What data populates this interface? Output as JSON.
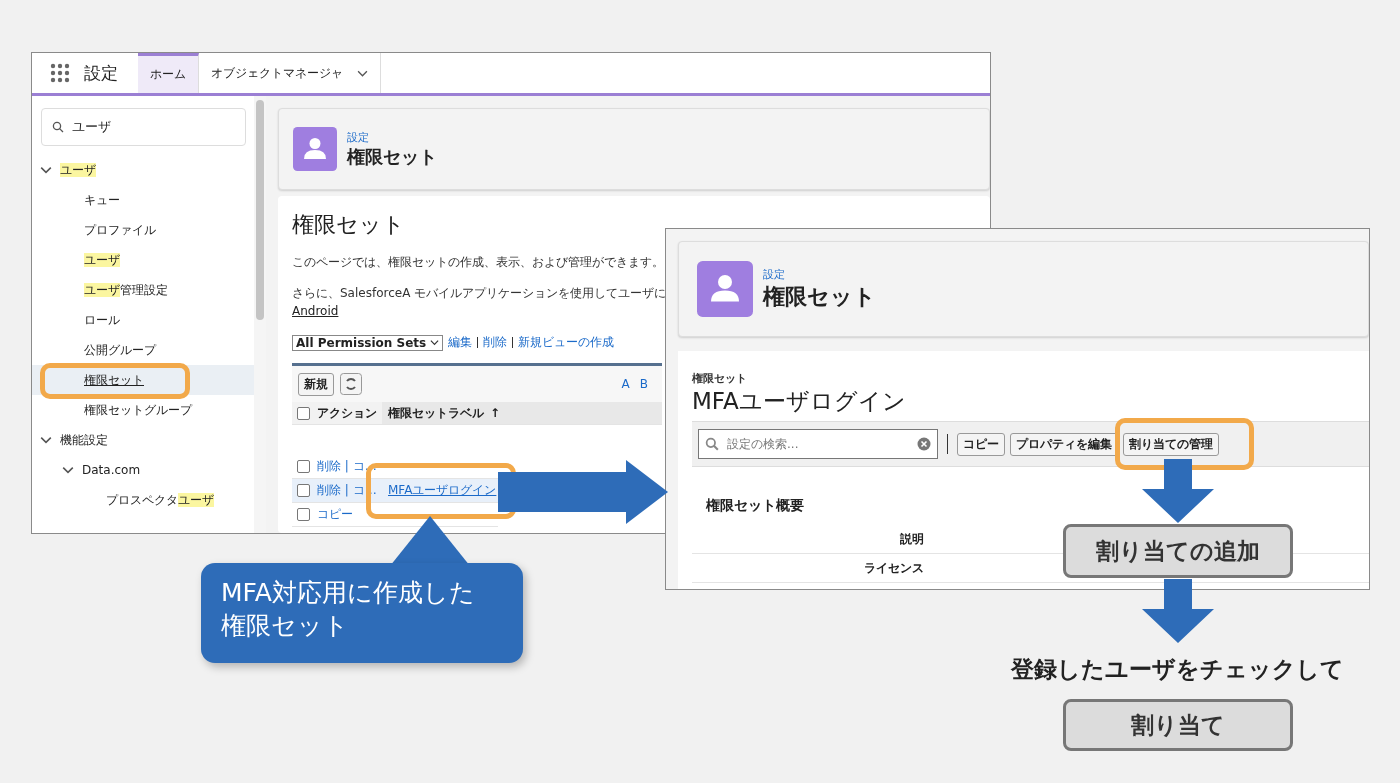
{
  "setup_window": {
    "app_title": "設定",
    "tabs": [
      {
        "label": "ホーム",
        "selected": true
      },
      {
        "label": "オブジェクトマネージャ",
        "selected": false
      }
    ],
    "sidebar": {
      "search": {
        "value": "ユーザ"
      },
      "tree": [
        {
          "label": [
            {
              "text": "ユーザ",
              "match": true
            }
          ],
          "expanded": true,
          "selected": false,
          "children": [
            {
              "label": [
                {
                  "text": "キュー",
                  "match": false
                }
              ],
              "selected": false
            },
            {
              "label": [
                {
                  "text": "プロファイル",
                  "match": false
                }
              ],
              "selected": false
            },
            {
              "label": [
                {
                  "text": "ユーザ",
                  "match": true
                }
              ],
              "selected": false
            },
            {
              "label": [
                {
                  "text": "ユーザ",
                  "match": true
                },
                {
                  "text": "管理設定",
                  "match": false
                }
              ],
              "selected": false
            },
            {
              "label": [
                {
                  "text": "ロール",
                  "match": false
                }
              ],
              "selected": false
            },
            {
              "label": [
                {
                  "text": "公開グループ",
                  "match": false
                }
              ],
              "selected": false
            },
            {
              "label": [
                {
                  "text": "権限セット",
                  "match": false
                }
              ],
              "selected": true
            },
            {
              "label": [
                {
                  "text": "権限セットグループ",
                  "match": false
                }
              ],
              "selected": false
            }
          ]
        },
        {
          "label": [
            {
              "text": "機能設定",
              "match": false
            }
          ],
          "expanded": true,
          "selected": false,
          "children": [
            {
              "label": [
                {
                  "text": "Data.com",
                  "match": false
                }
              ],
              "expanded": true,
              "selected": false,
              "children": [
                {
                  "label": [
                    {
                      "text": "プロスペクタ",
                      "match": false
                    },
                    {
                      "text": "ユーザ",
                      "match": true
                    }
                  ],
                  "selected": false
                }
              ]
            }
          ]
        }
      ]
    },
    "header": {
      "breadcrumb": "設定",
      "title": "権限セット"
    },
    "page": {
      "title": "権限セット",
      "description": "このページでは、権限セットの作成、表示、および管理ができます。",
      "note": "さらに、SalesforceA モバイルアプリケーションを使用してユーザに",
      "note_link": "Android",
      "view": {
        "value": "All Permission Sets",
        "links": [
          "編集",
          "削除",
          "新規ビューの作成"
        ]
      },
      "table": {
        "new_button": "新規",
        "letters": [
          "A",
          "B"
        ],
        "columns": [
          "アクション",
          "権限セットラベル"
        ],
        "sort_mark": "↑",
        "all_checked": false,
        "rows": [
          {
            "action": "削除 | コ…",
            "checked": false,
            "selected": false
          },
          {
            "action": "削除 | コ…",
            "label": "MFAユーザログイン",
            "checked": false,
            "selected": true
          },
          {
            "action": "コピー",
            "checked": false,
            "selected": false
          }
        ]
      }
    }
  },
  "detail_window": {
    "header": {
      "breadcrumb": "設定",
      "title": "権限セット"
    },
    "object_type": "権限セット",
    "record_title": "MFAユーザログイン",
    "search": {
      "placeholder": "設定の検索..."
    },
    "buttons": [
      "コピー",
      "プロパティを編集",
      "割り当ての管理"
    ],
    "section": {
      "title": "権限セット概要",
      "fields": [
        "説明",
        "ライセンス"
      ]
    }
  },
  "callout": {
    "lines": [
      "MFA対応用に作成した",
      "権限セット"
    ]
  },
  "steps": [
    {
      "kind": "button",
      "label": "割り当ての追加"
    },
    {
      "kind": "text",
      "label": "登録したユーザをチェックして"
    },
    {
      "kind": "button",
      "label": "割り当て"
    }
  ]
}
